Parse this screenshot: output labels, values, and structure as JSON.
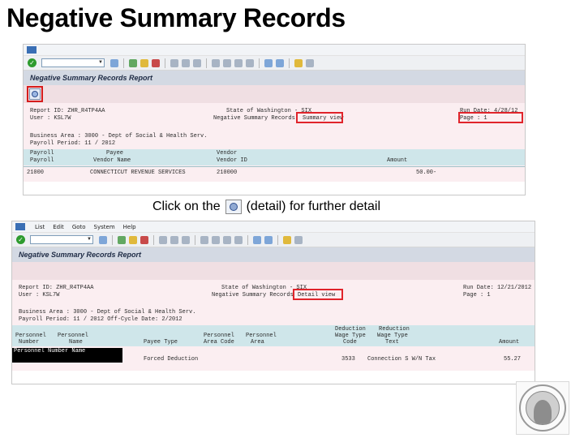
{
  "slide": {
    "title": "Negative Summary Records",
    "caption_before": "Click on the",
    "caption_after": "(detail) for further detail"
  },
  "window1": {
    "title": "Negative Summary Records Report",
    "report_lines": {
      "report": "Report  ID: ZHR_R4TP4AA",
      "user": "User      : KSL7W",
      "state": "State  of Washington  -  SIX",
      "subtitle": "Negative Summary Records",
      "summary": "Summary view",
      "run_date": "Run Date: 4/28/12",
      "page": "Page    :    1",
      "business_area": "Business Area : 3000 - Dept of Social & Health Serv.",
      "payroll_period": "Payroll Period: 11 / 2012",
      "col_payroll_l1": "Payroll",
      "col_payee_l1": "Payee",
      "col_vendor_l1": "Vendor",
      "col_payroll_l2": "Payroll",
      "col_payee_l2": "Vendor Name",
      "col_vendor_l2": "Vendor ID",
      "col_amount": "Amount",
      "row_code": "21000",
      "row_name": "CONNECTICUT REVENUE SERVICES",
      "row_vendor": "210000",
      "row_amount": "50.00-"
    }
  },
  "window2": {
    "menu": [
      "List",
      "Edit",
      "Goto",
      "System",
      "Help"
    ],
    "title": "Negative Summary Records Report",
    "report_lines": {
      "report": "Report  ID: ZHR_R4TP4AA",
      "user": "User      : KSL7W",
      "state": "State  of Washington  -  SIX",
      "subtitle": "Negative Summary Records",
      "detail": "Detail view",
      "run_date": "Run Date: 12/21/2012",
      "page": "Page    :    1",
      "business_area": "Business Area : 3000 - Dept of Social & Health Serv.",
      "payroll_period": "Payroll Period: 11 / 2012    Off-Cycle Date: 2/2012",
      "header_right_1": "Deduction",
      "header_right_2": "Reduction",
      "col1_l1": "Personnel",
      "col2_l1": "Personnel",
      "col4_l1": "Personnel",
      "col5_l1": "Personnel",
      "col6_l1": "Wage Type",
      "col7_l1": "Wage Type",
      "col1_l2": "Number",
      "col2_l2": "Name",
      "col3_l2": "Payee Type",
      "col4_l2": "Area Code",
      "col5_l2": "Area",
      "col6_l2": "Code",
      "col7_l2": "Text",
      "col8_l2": "Amount",
      "sel_row": "Personnel Number Name",
      "row_payee": "Forced Deduction",
      "row_code": "3533",
      "row_text": "Connection  S  W/N Tax",
      "row_amount": "55.27"
    }
  }
}
